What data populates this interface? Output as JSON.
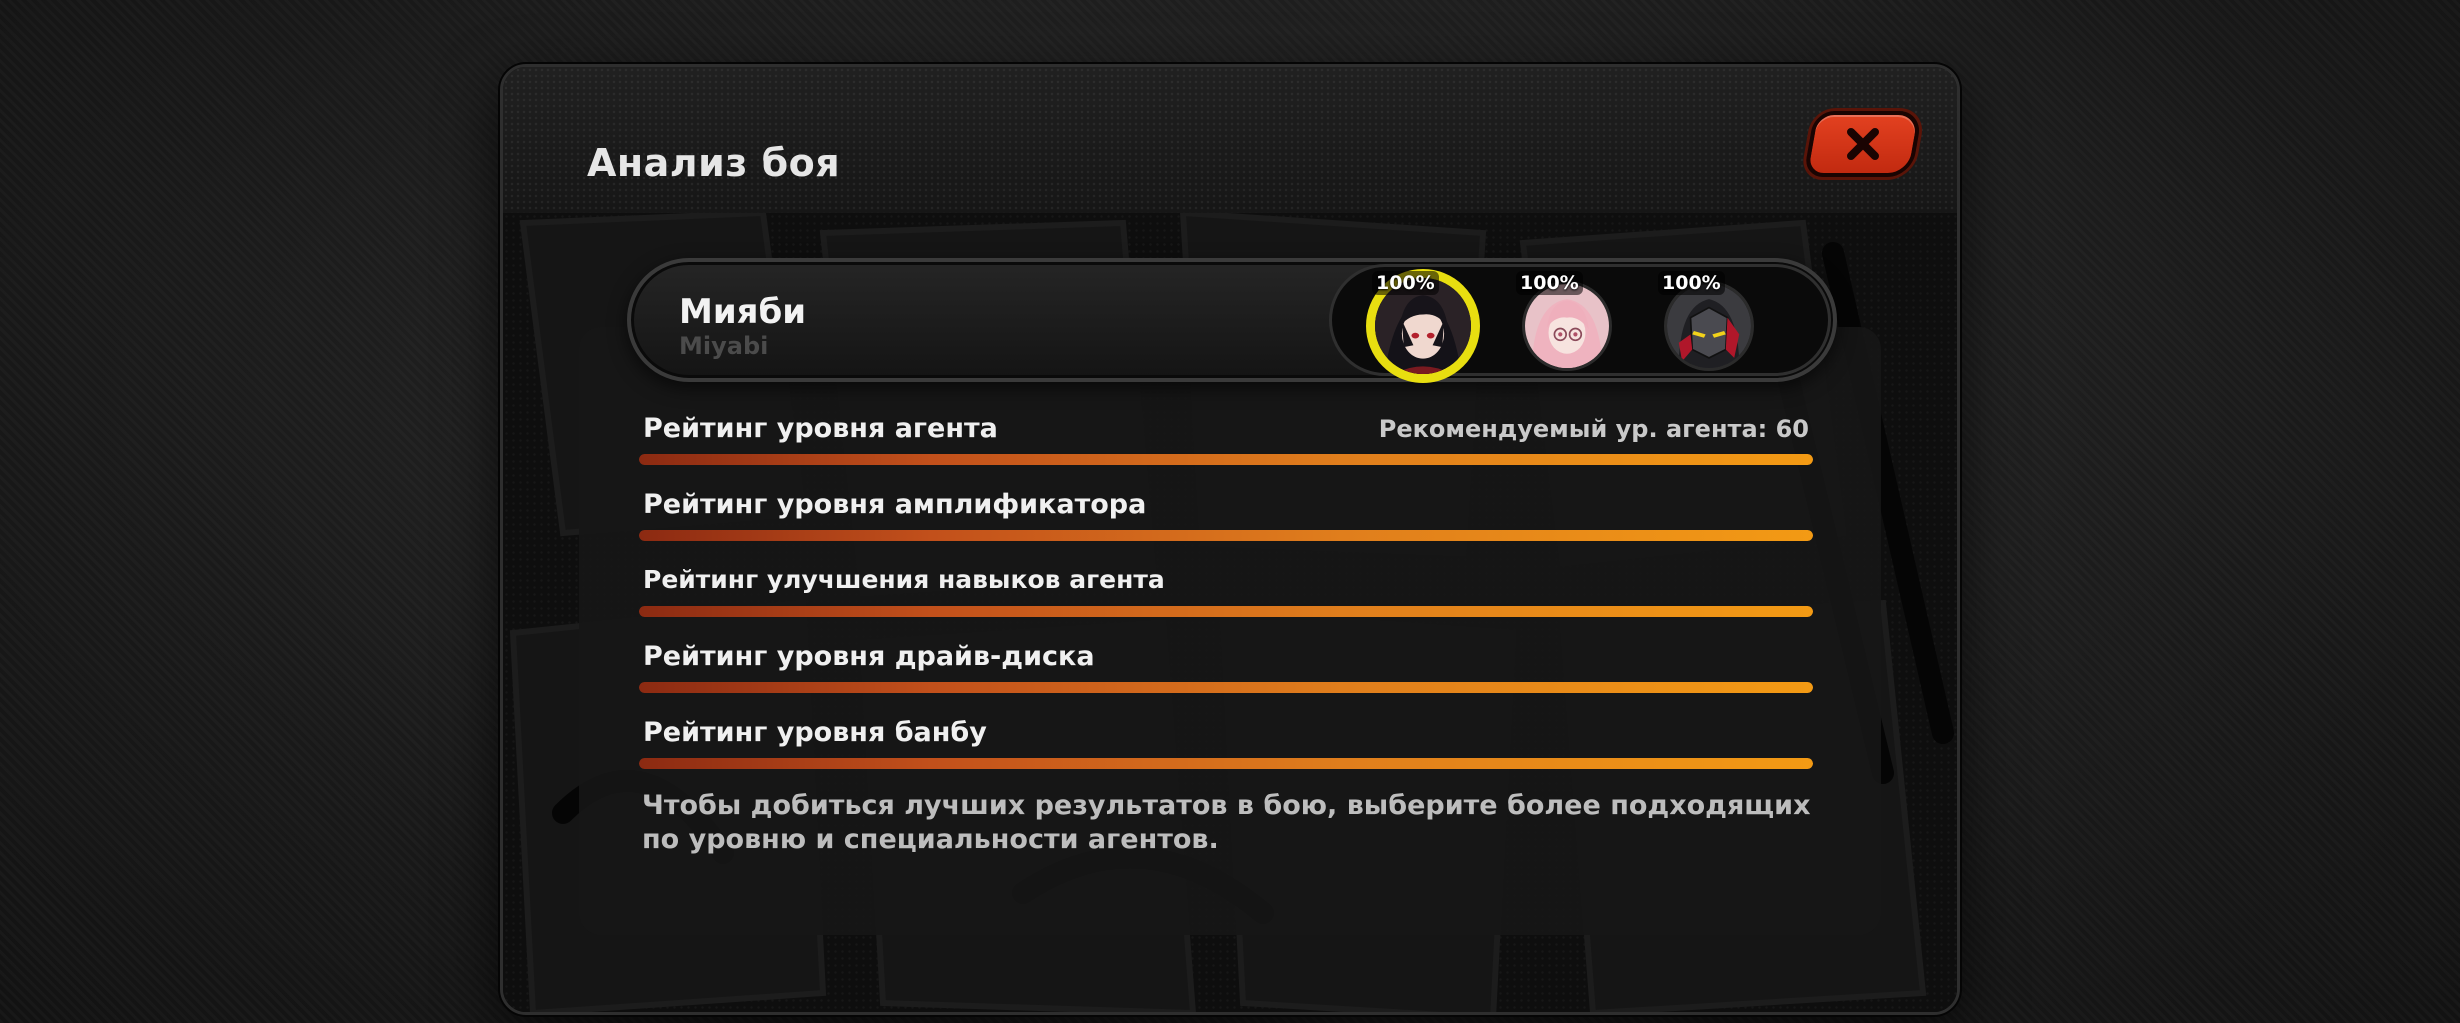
{
  "dialog": {
    "title": "Анализ боя",
    "close_icon": "close-icon",
    "accent_color": "#d9381b"
  },
  "agent": {
    "name": "Мияби",
    "subname": "Miyabi"
  },
  "squad": [
    {
      "name": "Miyabi",
      "percent_label": "100%",
      "selected": true,
      "icon": "agent-portrait-icon"
    },
    {
      "name": "Yanagi",
      "percent_label": "100%",
      "selected": false,
      "icon": "agent-portrait-icon"
    },
    {
      "name": "Soldier 11",
      "percent_label": "100%",
      "selected": false,
      "icon": "agent-portrait-icon"
    }
  ],
  "ratings": [
    {
      "label": "Рейтинг уровня агента",
      "note": "Рекомендуемый ур. агента: 60",
      "fill": 1.0
    },
    {
      "label": "Рейтинг уровня амплификатора",
      "fill": 1.0
    },
    {
      "label": "Рейтинг улучшения навыков агента",
      "fill": 1.0
    },
    {
      "label": "Рейтинг уровня драйв-диска",
      "fill": 1.0
    },
    {
      "label": "Рейтинг уровня банбу",
      "fill": 1.0
    }
  ],
  "hint": "Чтобы добиться лучших результатов в бою, выберите более подходящих по уровню и специальности агентов.",
  "colors": {
    "bar_start": "#8c2a12",
    "bar_end": "#f39a14",
    "selected_ring": "#e8de10"
  }
}
